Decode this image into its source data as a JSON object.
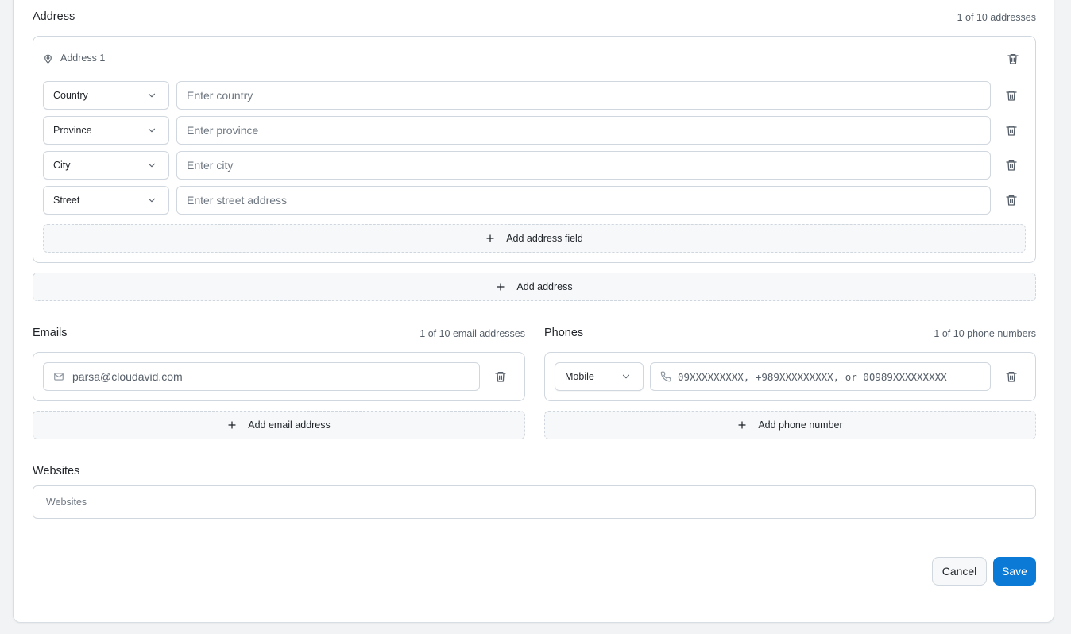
{
  "address": {
    "title": "Address",
    "count": "1 of 10 addresses",
    "card_label": "Address 1",
    "fields": [
      {
        "type": "Country",
        "placeholder": "Enter country"
      },
      {
        "type": "Province",
        "placeholder": "Enter province"
      },
      {
        "type": "City",
        "placeholder": "Enter city"
      },
      {
        "type": "Street",
        "placeholder": "Enter street address"
      }
    ],
    "add_field_label": "Add address field",
    "add_address_label": "Add address"
  },
  "emails": {
    "title": "Emails",
    "count": "1 of 10 email addresses",
    "value": "parsa@cloudavid.com",
    "add_label": "Add email address"
  },
  "phones": {
    "title": "Phones",
    "count": "1 of 10 phone numbers",
    "type": "Mobile",
    "placeholder": "09XXXXXXXXX, +989XXXXXXXXX, or 00989XXXXXXXXX",
    "add_label": "Add phone number"
  },
  "websites": {
    "title": "Websites",
    "placeholder": "Websites"
  },
  "actions": {
    "cancel": "Cancel",
    "save": "Save"
  },
  "colors": {
    "primary": "#0a7ad6",
    "border": "#d0d7de",
    "dashed_bg": "#f6f8fa"
  }
}
